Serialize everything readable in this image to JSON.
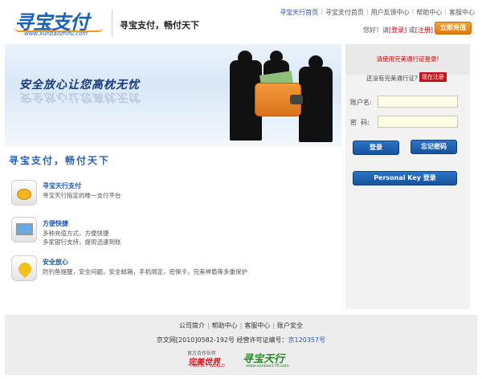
{
  "header": {
    "logo_text": "寻宝支付",
    "logo_url": "www.xunbaozhifu.com",
    "slogan": "寻宝支付，畅付天下",
    "nav": [
      "寻宝天行首页",
      "寻宝支付首页",
      "用户反馈中心",
      "帮助中心",
      "客服中心"
    ],
    "user_prefix": "您好！请",
    "login_link": "[登录]",
    "or": " 或",
    "register_link": "[注册]",
    "recharge_label": "立即充值"
  },
  "banner": {
    "text": "安全放心让您高枕无忧"
  },
  "login": {
    "warning": "请使用完美通行证登录!",
    "question": "还没有完美通行证?",
    "register_now": "现在注册",
    "account_label": "账户名:",
    "password_label": "密  码:",
    "account_value": "",
    "password_value": "",
    "login_button": "登录",
    "forgot_button": "忘记密码",
    "personal_key_button": "Personal Key 登录"
  },
  "main": {
    "title": "寻宝支付，畅付天下",
    "features": [
      {
        "title": "寻宝天行支付",
        "desc": [
          "寻宝天行指定的唯一支付平台"
        ],
        "icon": "coins-icon"
      },
      {
        "title": "方便快捷",
        "desc": [
          "多种充值方式，方便快捷",
          "多家银行支持，提现迅速到账"
        ],
        "icon": "monitor-icon"
      },
      {
        "title": "安全放心",
        "desc": [
          "防钓鱼提醒，安全问题，安全邮箱，手机绑定，密保卡，完美神盾等多重保护"
        ],
        "icon": "key-icon"
      }
    ]
  },
  "footer": {
    "links": [
      "公司简介",
      "帮助中心",
      "客服中心",
      "账户安全"
    ],
    "icp_prefix": "京文网[2010]0582-192号  经营许可证编号：",
    "icp_number": "京120357号",
    "partner_caption": "官方合作伙伴",
    "partner1": "完美世界",
    "partner1_sub": "PERFECT WORLD",
    "partner2": "寻宝天行",
    "partner2_sub": "www.xunbao178.com"
  },
  "colors": {
    "brand_blue": "#1a62b8",
    "accent_orange": "#e07a09",
    "alert_red": "#c4141a"
  }
}
